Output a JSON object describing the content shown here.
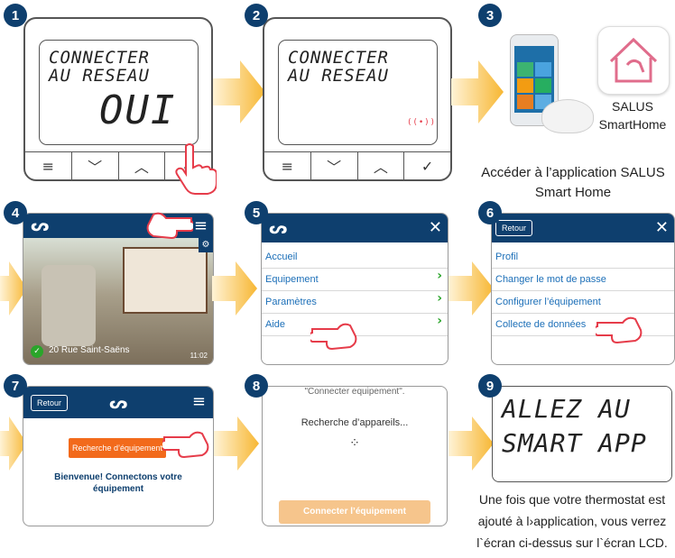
{
  "steps": [
    "1",
    "2",
    "3",
    "4",
    "5",
    "6",
    "7",
    "8",
    "9"
  ],
  "step1": {
    "line1": "CONNECTER",
    "line2": "AU RESEAU",
    "big": "OUI"
  },
  "step2": {
    "line1": "CONNECTER",
    "line2": "AU RESEAU",
    "signal": "((•))"
  },
  "thermostat_buttons": [
    "≡",
    "﹀",
    "︿",
    "✓"
  ],
  "step3": {
    "logo_line1": "SALUS",
    "logo_line2": "SmartHome",
    "caption_line1": "Accéder à l’application SALUS",
    "caption_line2": "Smart Home"
  },
  "step4": {
    "address": "20 Rue Saint-Saëns",
    "time": "11:02"
  },
  "step5": {
    "items": [
      "Accueil",
      "Equipement",
      "Paramètres",
      "Aide"
    ]
  },
  "step6": {
    "back": "Retour",
    "items": [
      "Profil",
      "Changer le mot de passe",
      "Configurer l’équipement",
      "Collecte de données"
    ]
  },
  "step7": {
    "back": "Retour",
    "search_button": "Recherche d’équipement",
    "welcome_line1": "Bienvenue! Connectons votre",
    "welcome_line2": "équipement"
  },
  "step8": {
    "top": "\"Connecter equipement\".",
    "searching": "Recherche d’appareils...",
    "connect_button": "Connecter l’équipement"
  },
  "step9": {
    "line1": "ALLEZ AU",
    "line2": "SMART APP",
    "caption": [
      "Une fois que votre thermostat est",
      "ajouté à l›application, vous verrez",
      "l`écran ci-dessus sur l`écran LCD."
    ]
  },
  "colors": {
    "navy": "#0e3f6e",
    "arrow": "#f7c35b",
    "orange": "#f26a1b",
    "green": "#2aa52a",
    "link": "#1c6fb8"
  }
}
